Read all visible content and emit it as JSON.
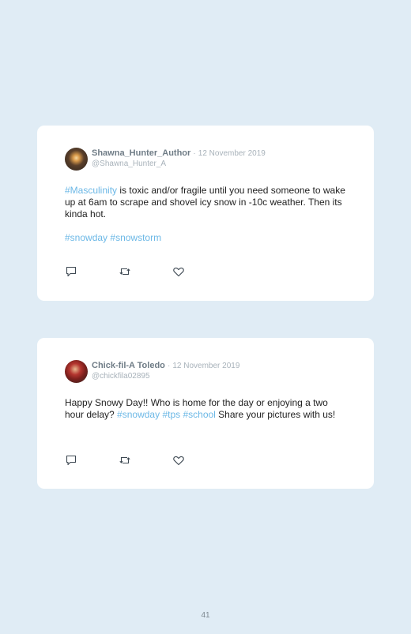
{
  "tweets": [
    {
      "name": "Shawna_Hunter_Author",
      "separator": "·",
      "date": "12 November 2019",
      "handle": "@Shawna_Hunter_A",
      "body": {
        "tag1": "#Masculinity",
        "text1": " is toxic and/or fragile until you need someone to wake up at 6am to scrape and shovel icy snow in -10c weather. Then its kinda hot."
      },
      "hashtags": [
        "#snowday",
        "#snowstorm"
      ],
      "avatar_icon": "person-photo"
    },
    {
      "name": "Chick-fil-A Toledo",
      "separator": "·",
      "date": "12 November 2019",
      "handle": "@chickfila02895",
      "body": {
        "text1": "Happy Snowy Day!! Who is home for the day or enjoying a two hour delay? ",
        "tag1": "#snowday",
        "tag2": "#tps",
        "tag3": "#school",
        "text2": " Share your pictures with us!"
      },
      "avatar_icon": "chick-fil-a-logo-photo"
    }
  ],
  "icons": [
    "reply-icon",
    "retweet-icon",
    "like-icon"
  ],
  "colors": {
    "background": "#e0ecf5",
    "card": "#ffffff",
    "hashtag": "#6cb8e6",
    "name": "#6f7c86",
    "muted": "#a8b2ba"
  },
  "page_number": "41"
}
